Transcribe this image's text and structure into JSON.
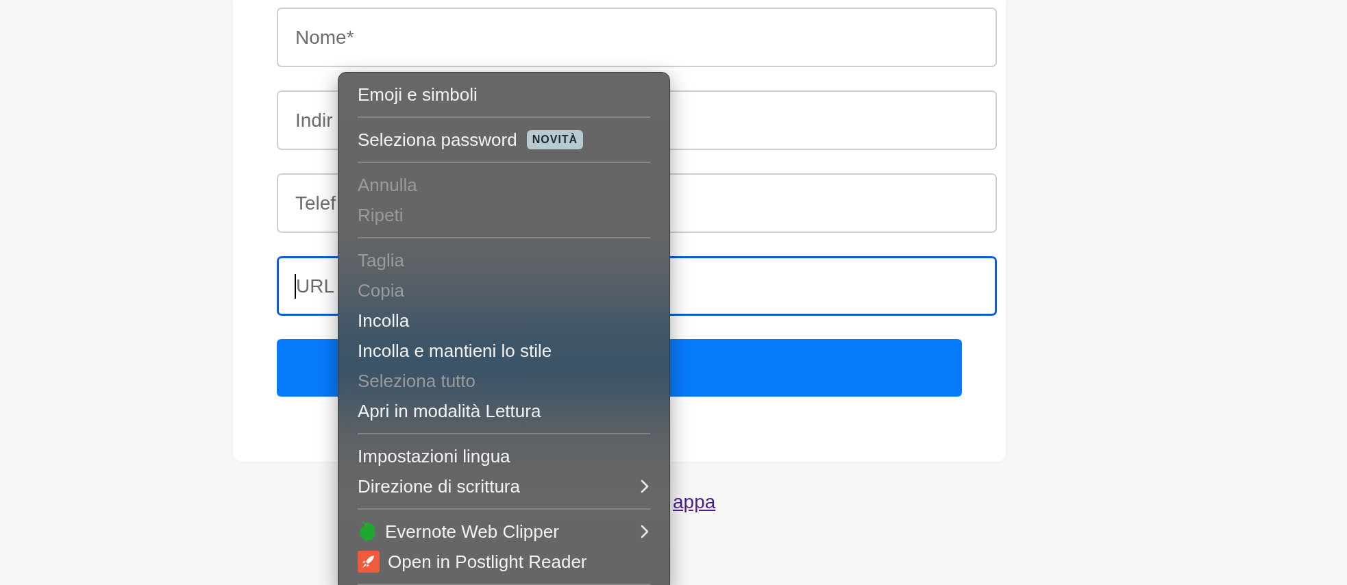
{
  "form": {
    "fields": [
      {
        "placeholder": "Nome*",
        "focused": false
      },
      {
        "placeholder": "Indir",
        "focused": false
      },
      {
        "placeholder": "Telef",
        "focused": false
      },
      {
        "placeholder": "URL",
        "focused": true
      }
    ]
  },
  "link": "appa",
  "context_menu": {
    "items": [
      {
        "kind": "item",
        "label": "Emoji e simboli",
        "disabled": false
      },
      {
        "kind": "separator"
      },
      {
        "kind": "item",
        "label": "Seleziona password",
        "disabled": false,
        "badge": "NOVITÀ"
      },
      {
        "kind": "separator"
      },
      {
        "kind": "item",
        "label": "Annulla",
        "disabled": true
      },
      {
        "kind": "item",
        "label": "Ripeti",
        "disabled": true
      },
      {
        "kind": "separator"
      },
      {
        "kind": "item",
        "label": "Taglia",
        "disabled": true
      },
      {
        "kind": "item",
        "label": "Copia",
        "disabled": true
      },
      {
        "kind": "item",
        "label": "Incolla",
        "disabled": false
      },
      {
        "kind": "item",
        "label": "Incolla e mantieni lo stile",
        "disabled": false
      },
      {
        "kind": "item",
        "label": "Seleziona tutto",
        "disabled": true
      },
      {
        "kind": "item",
        "label": "Apri in modalità Lettura",
        "disabled": false
      },
      {
        "kind": "separator"
      },
      {
        "kind": "item",
        "label": "Impostazioni lingua",
        "disabled": false
      },
      {
        "kind": "item",
        "label": "Direzione di scrittura",
        "disabled": false,
        "submenu": true
      },
      {
        "kind": "separator"
      },
      {
        "kind": "app_item",
        "label": "Evernote Web Clipper",
        "disabled": false,
        "submenu": true
      },
      {
        "kind": "app_item",
        "label": "Open in Postlight Reader",
        "disabled": false
      },
      {
        "kind": "separator"
      }
    ]
  }
}
